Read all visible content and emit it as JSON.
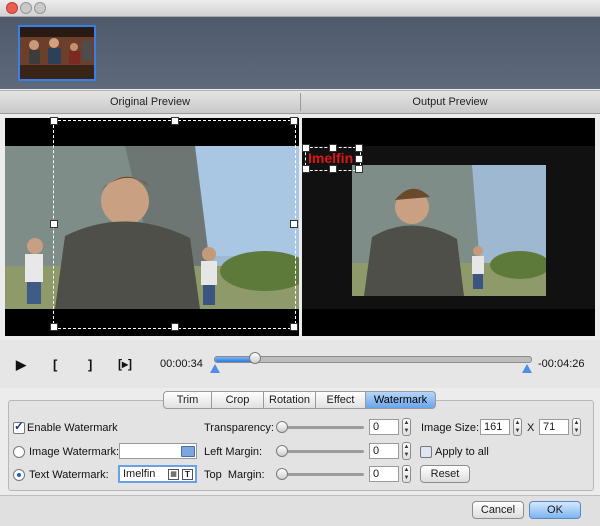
{
  "preview": {
    "original_label": "Original Preview",
    "output_label": "Output Preview",
    "watermark_overlay_text": "Imelfin"
  },
  "playback": {
    "current_time": "00:00:34",
    "remaining_time": "-00:04:26",
    "play_glyph": "▶",
    "mark_in_glyph": "[",
    "mark_out_glyph": "]",
    "next_glyph": "[▸]",
    "progress_fraction": 0.13
  },
  "tabs": [
    {
      "label": "Trim",
      "active": false
    },
    {
      "label": "Crop",
      "active": false
    },
    {
      "label": "Rotation",
      "active": false
    },
    {
      "label": "Effect",
      "active": false
    },
    {
      "label": "Watermark",
      "active": true
    }
  ],
  "watermark": {
    "enable_label": "Enable Watermark",
    "enable_checked": true,
    "image_label": "Image Watermark:",
    "image_value": "",
    "text_label": "Text Watermark:",
    "text_value": "Imelfin",
    "transparency_label": "Transparency:",
    "transparency_value": "0",
    "left_margin_label": "Left Margin:",
    "left_margin_value": "0",
    "top_margin_label": "Top  Margin:",
    "top_margin_value": "0",
    "image_size_label": "Image Size:",
    "image_width": "161",
    "size_separator": "X",
    "image_height": "71",
    "apply_all_label": "Apply to all",
    "reset_label": "Reset"
  },
  "footer": {
    "cancel_label": "Cancel",
    "ok_label": "OK"
  },
  "colors": {
    "accent": "#3a7ee8",
    "watermark_text": "#e01515"
  },
  "icons": {
    "folder": "folder-icon",
    "text_font": "font-icon",
    "text_style": "text-icon"
  }
}
